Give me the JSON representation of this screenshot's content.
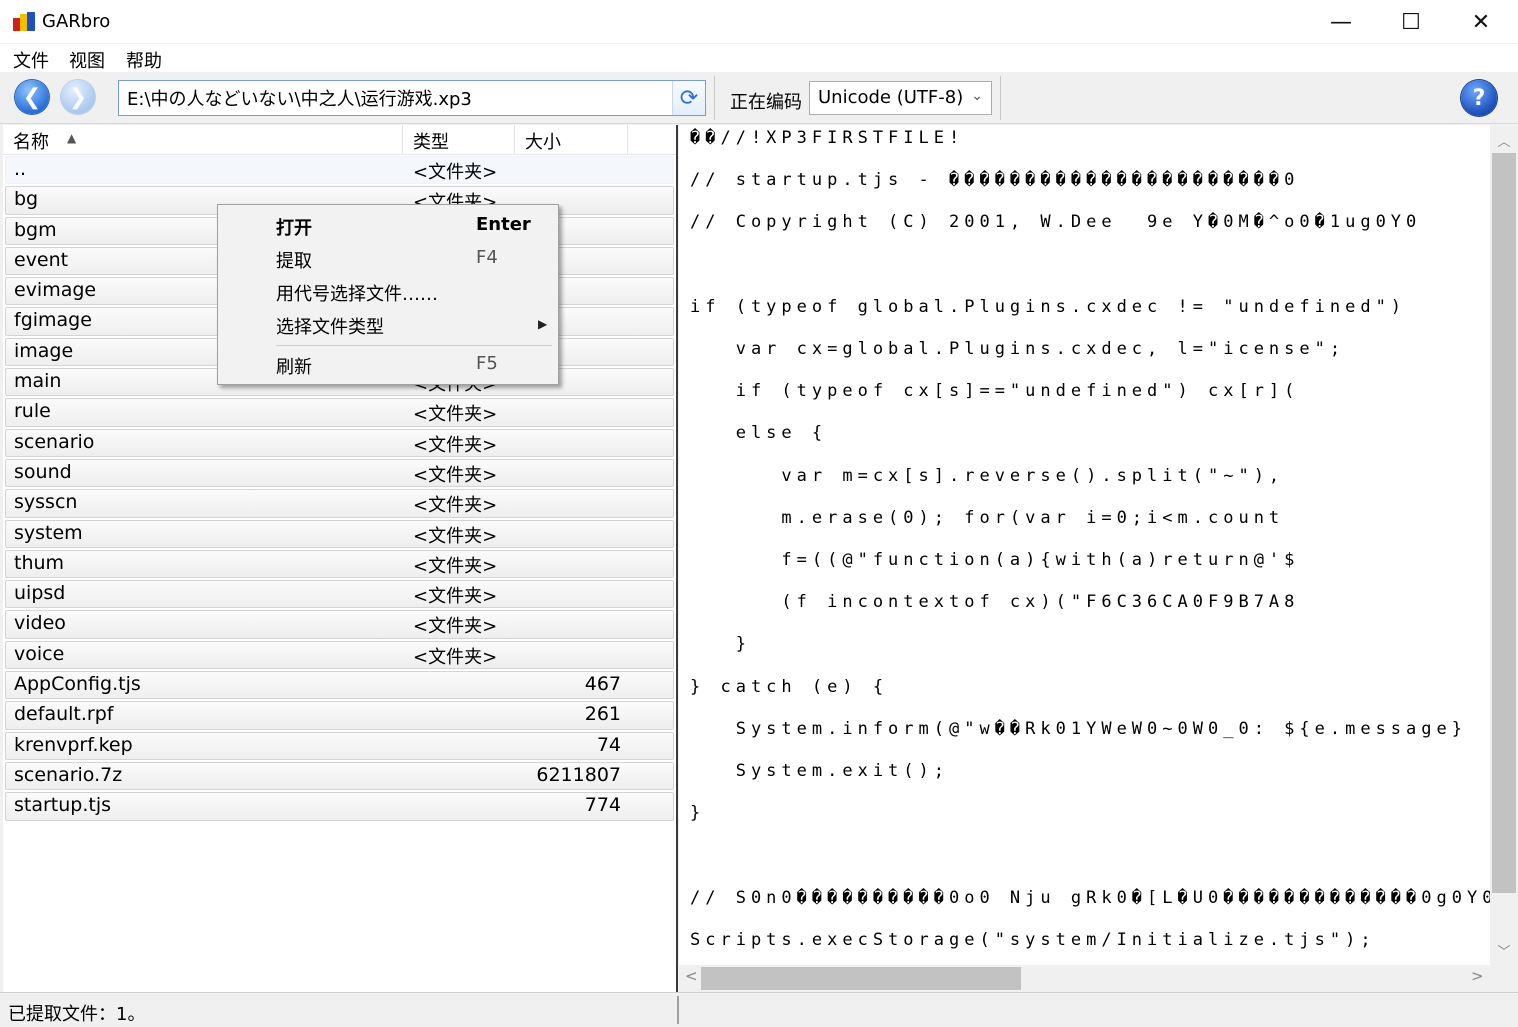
{
  "window": {
    "title": "GARbro",
    "minimize_glyph": "—",
    "maximize_glyph": "☐",
    "close_glyph": "✕"
  },
  "menubar": {
    "items": [
      "文件",
      "视图",
      "帮助"
    ]
  },
  "toolbar": {
    "back_icon": "back-arrow-icon",
    "forward_icon": "forward-arrow-icon",
    "path_value": "E:\\中の人などいない\\中之人\\运行游戏.xp3",
    "refresh_glyph": "⟳",
    "encoding_label": "正在编码",
    "encoding_value": "Unicode (UTF-8)",
    "help_glyph": "?"
  },
  "file_list": {
    "columns": [
      "名称",
      "类型",
      "大小"
    ],
    "sort_glyph": "▲",
    "rows": [
      {
        "name": "..",
        "type": "<文件夹>",
        "size": ""
      },
      {
        "name": "bg",
        "type": "<文件夹>",
        "size": ""
      },
      {
        "name": "bgm",
        "type": "",
        "size": ""
      },
      {
        "name": "event",
        "type": "",
        "size": ""
      },
      {
        "name": "evimage",
        "type": "",
        "size": ""
      },
      {
        "name": "fgimage",
        "type": "",
        "size": ""
      },
      {
        "name": "image",
        "type": "",
        "size": ""
      },
      {
        "name": "main",
        "type": "<文件夹>",
        "size": ""
      },
      {
        "name": "rule",
        "type": "<文件夹>",
        "size": ""
      },
      {
        "name": "scenario",
        "type": "<文件夹>",
        "size": ""
      },
      {
        "name": "sound",
        "type": "<文件夹>",
        "size": ""
      },
      {
        "name": "sysscn",
        "type": "<文件夹>",
        "size": ""
      },
      {
        "name": "system",
        "type": "<文件夹>",
        "size": ""
      },
      {
        "name": "thum",
        "type": "<文件夹>",
        "size": ""
      },
      {
        "name": "uipsd",
        "type": "<文件夹>",
        "size": ""
      },
      {
        "name": "video",
        "type": "<文件夹>",
        "size": ""
      },
      {
        "name": "voice",
        "type": "<文件夹>",
        "size": ""
      },
      {
        "name": "AppConfig.tjs",
        "type": "",
        "size": "467"
      },
      {
        "name": "default.rpf",
        "type": "",
        "size": "261"
      },
      {
        "name": "krenvprf.kep",
        "type": "",
        "size": "74"
      },
      {
        "name": "scenario.7z",
        "type": "",
        "size": "6211807"
      },
      {
        "name": "startup.tjs",
        "type": "",
        "size": "774"
      }
    ]
  },
  "context_menu": {
    "items": [
      {
        "label": "打开",
        "shortcut": "Enter"
      },
      {
        "label": "提取",
        "shortcut": "F4"
      },
      {
        "label": "用代号选择文件……",
        "shortcut": ""
      },
      {
        "label": "选择文件类型",
        "shortcut": ""
      },
      {
        "label": "刷新",
        "shortcut": "F5"
      }
    ],
    "submenu_glyph": "▶"
  },
  "preview": {
    "lines": [
      "��//!XP3FIRSTFILE!",
      "// startup.tjs - ����������������������0",
      "// Copyright (C) 2001, W.Dee  9e Y�0M�^o0�1ug0Y0",
      "",
      "if (typeof global.Plugins.cxdec != \"undefined\")",
      "   var cx=global.Plugins.cxdec, l=\"icense\";",
      "   if (typeof cx[s]==\"undefined\") cx[r](",
      "   else {",
      "      var m=cx[s].reverse().split(\"~\"),",
      "      m.erase(0); for(var i=0;i<m.count",
      "      f=((@\"function(a){with(a)return@'$",
      "      (f incontextof cx)(\"F6C36CA0F9B7A8",
      "   }",
      "} catch (e) {",
      "   System.inform(@\"w��Rk01YWeW0~0W0_0: ${e.message}",
      "   System.exit();",
      "}",
      "",
      "// S0n0����������0o0 Nju gRk0�[L�U0�������������0g0Y0",
      "Scripts.execStorage(\"system/Initialize.tjs\");"
    ]
  },
  "scrollbars": {
    "up_glyph": "︿",
    "down_glyph": "﹀",
    "left_glyph": "<",
    "right_glyph": ">"
  },
  "statusbar": {
    "text": "已提取文件：1。"
  }
}
